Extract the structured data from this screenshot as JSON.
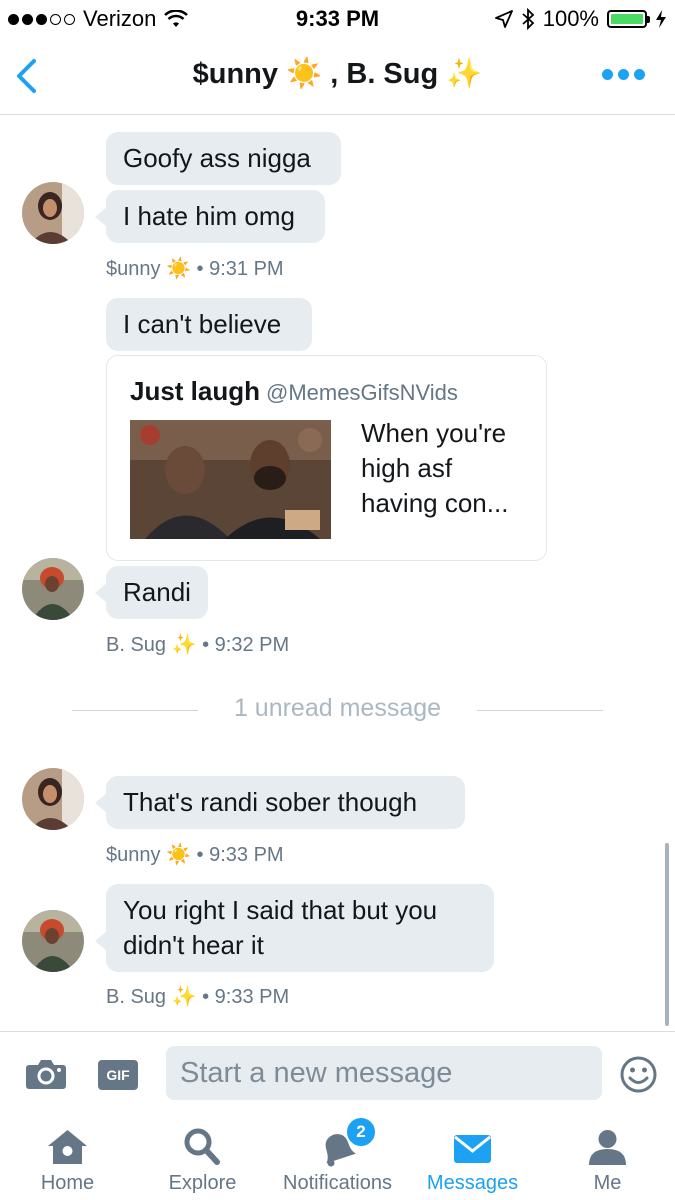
{
  "status_bar": {
    "carrier": "Verizon",
    "time": "9:33 PM",
    "battery": "100%"
  },
  "header": {
    "title_name_1": "$unny",
    "title_emoji_1": "☀️",
    "title_separator": ",",
    "title_name_2": "B. Sug",
    "title_emoji_2": "✨"
  },
  "messages": {
    "m1": "Goofy ass nigga",
    "m2": "I hate him omg",
    "meta1": {
      "sender": "$unny",
      "emoji": "☀️",
      "time": "9:31 PM"
    },
    "m3": "I can't believe",
    "card": {
      "name": "Just laugh",
      "handle": "@MemesGifsNVids",
      "text": "When you're high asf having con..."
    },
    "m4": "Randi",
    "meta2": {
      "sender": "B. Sug",
      "emoji": "✨",
      "time": "9:32 PM"
    },
    "unread": "1 unread message",
    "m5": "That's randi sober though",
    "meta3": {
      "sender": "$unny",
      "emoji": "☀️",
      "time": "9:33 PM"
    },
    "m6": "You right I said that but you didn't hear it",
    "meta4": {
      "sender": "B. Sug",
      "emoji": "✨",
      "time": "9:33 PM"
    }
  },
  "composer": {
    "gif_label": "GIF",
    "placeholder": "Start a new message"
  },
  "tabs": {
    "home": "Home",
    "explore": "Explore",
    "notifications": "Notifications",
    "messages": "Messages",
    "me": "Me",
    "notifications_badge": "2"
  },
  "colors": {
    "accent": "#1da1f2",
    "bubble": "#e6ecf0",
    "meta_text": "#657786"
  }
}
